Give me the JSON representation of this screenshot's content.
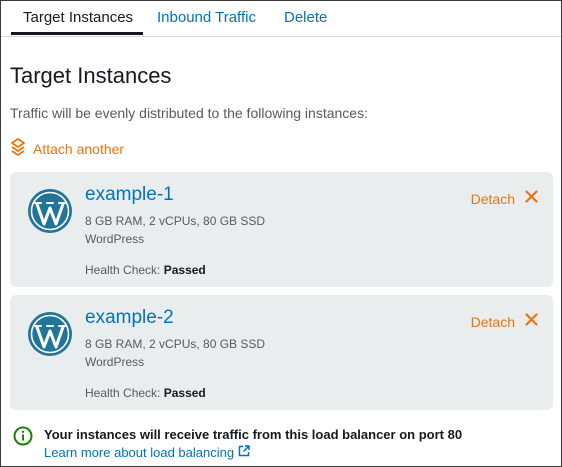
{
  "tabs": [
    {
      "label": "Target Instances"
    },
    {
      "label": "Inbound Traffic"
    },
    {
      "label": "Delete"
    }
  ],
  "page": {
    "title": "Target Instances",
    "subtitle": "Traffic will be evenly distributed to the following instances:",
    "attach_label": "Attach another"
  },
  "instances": [
    {
      "name": "example-1",
      "specs": "8 GB RAM, 2 vCPUs, 80 GB SSD",
      "os": "WordPress",
      "health_label": "Health Check:",
      "health_status": "Passed",
      "detach_label": "Detach"
    },
    {
      "name": "example-2",
      "specs": "8 GB RAM, 2 vCPUs, 80 GB SSD",
      "os": "WordPress",
      "health_label": "Health Check:",
      "health_status": "Passed",
      "detach_label": "Detach"
    }
  ],
  "info": {
    "message": "Your instances will receive traffic from this load balancer on port 80",
    "link": "Learn more about load balancing"
  },
  "colors": {
    "link": "#0073bb",
    "accent": "#ec7211",
    "card_bg": "#eaeded",
    "info_green": "#1d8102"
  },
  "icons": {
    "attach": "attach-icon",
    "instance": "wordpress-icon",
    "detach": "close-icon",
    "info": "info-circle-icon",
    "external": "external-link-icon"
  }
}
